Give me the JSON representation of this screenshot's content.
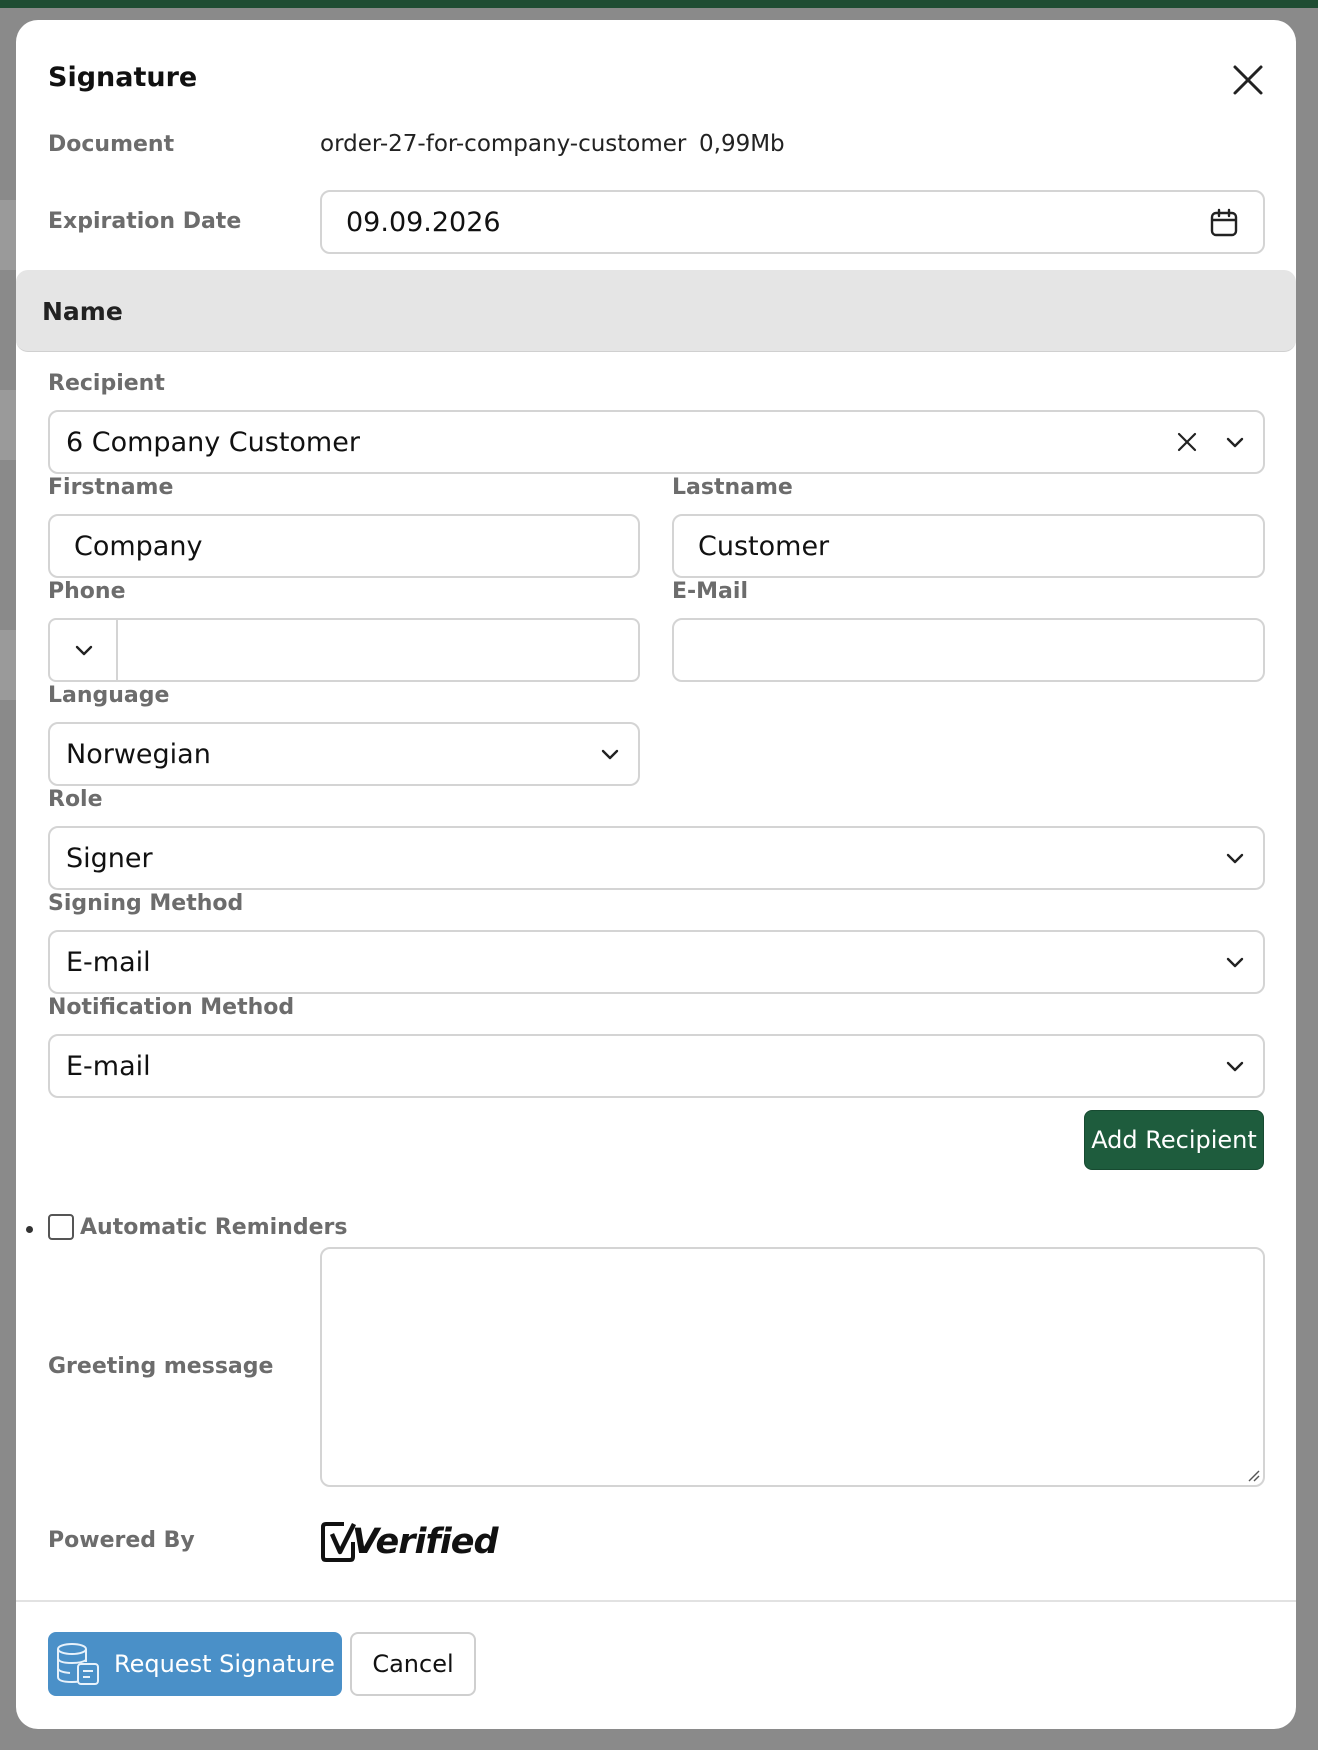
{
  "modal": {
    "title": "Signature"
  },
  "document": {
    "label": "Document",
    "filename": "order-27-for-company-customer",
    "size": "0,99Mb"
  },
  "expiration": {
    "label": "Expiration Date",
    "value": "09.09.2026"
  },
  "section": {
    "title": "Name"
  },
  "recipient": {
    "label": "Recipient",
    "value": "6 Company Customer"
  },
  "firstname": {
    "label": "Firstname",
    "value": "Company"
  },
  "lastname": {
    "label": "Lastname",
    "value": "Customer"
  },
  "phone": {
    "label": "Phone",
    "value": ""
  },
  "email": {
    "label": "E-Mail",
    "value": ""
  },
  "language": {
    "label": "Language",
    "value": "Norwegian"
  },
  "role": {
    "label": "Role",
    "value": "Signer"
  },
  "signing_method": {
    "label": "Signing Method",
    "value": "E-mail"
  },
  "notification_method": {
    "label": "Notification Method",
    "value": "E-mail"
  },
  "add_recipient": {
    "label": "Add Recipient"
  },
  "reminders": {
    "label": "Automatic Reminders",
    "checked": false
  },
  "greeting": {
    "label": "Greeting message",
    "value": ""
  },
  "powered": {
    "label": "Powered By",
    "logo_text": "Verified"
  },
  "footer": {
    "request_label": "Request Signature",
    "cancel_label": "Cancel"
  },
  "colors": {
    "primary_green": "#1e5c3d",
    "request_blue": "#4a90c8",
    "top_bar": "#1f4d33"
  }
}
